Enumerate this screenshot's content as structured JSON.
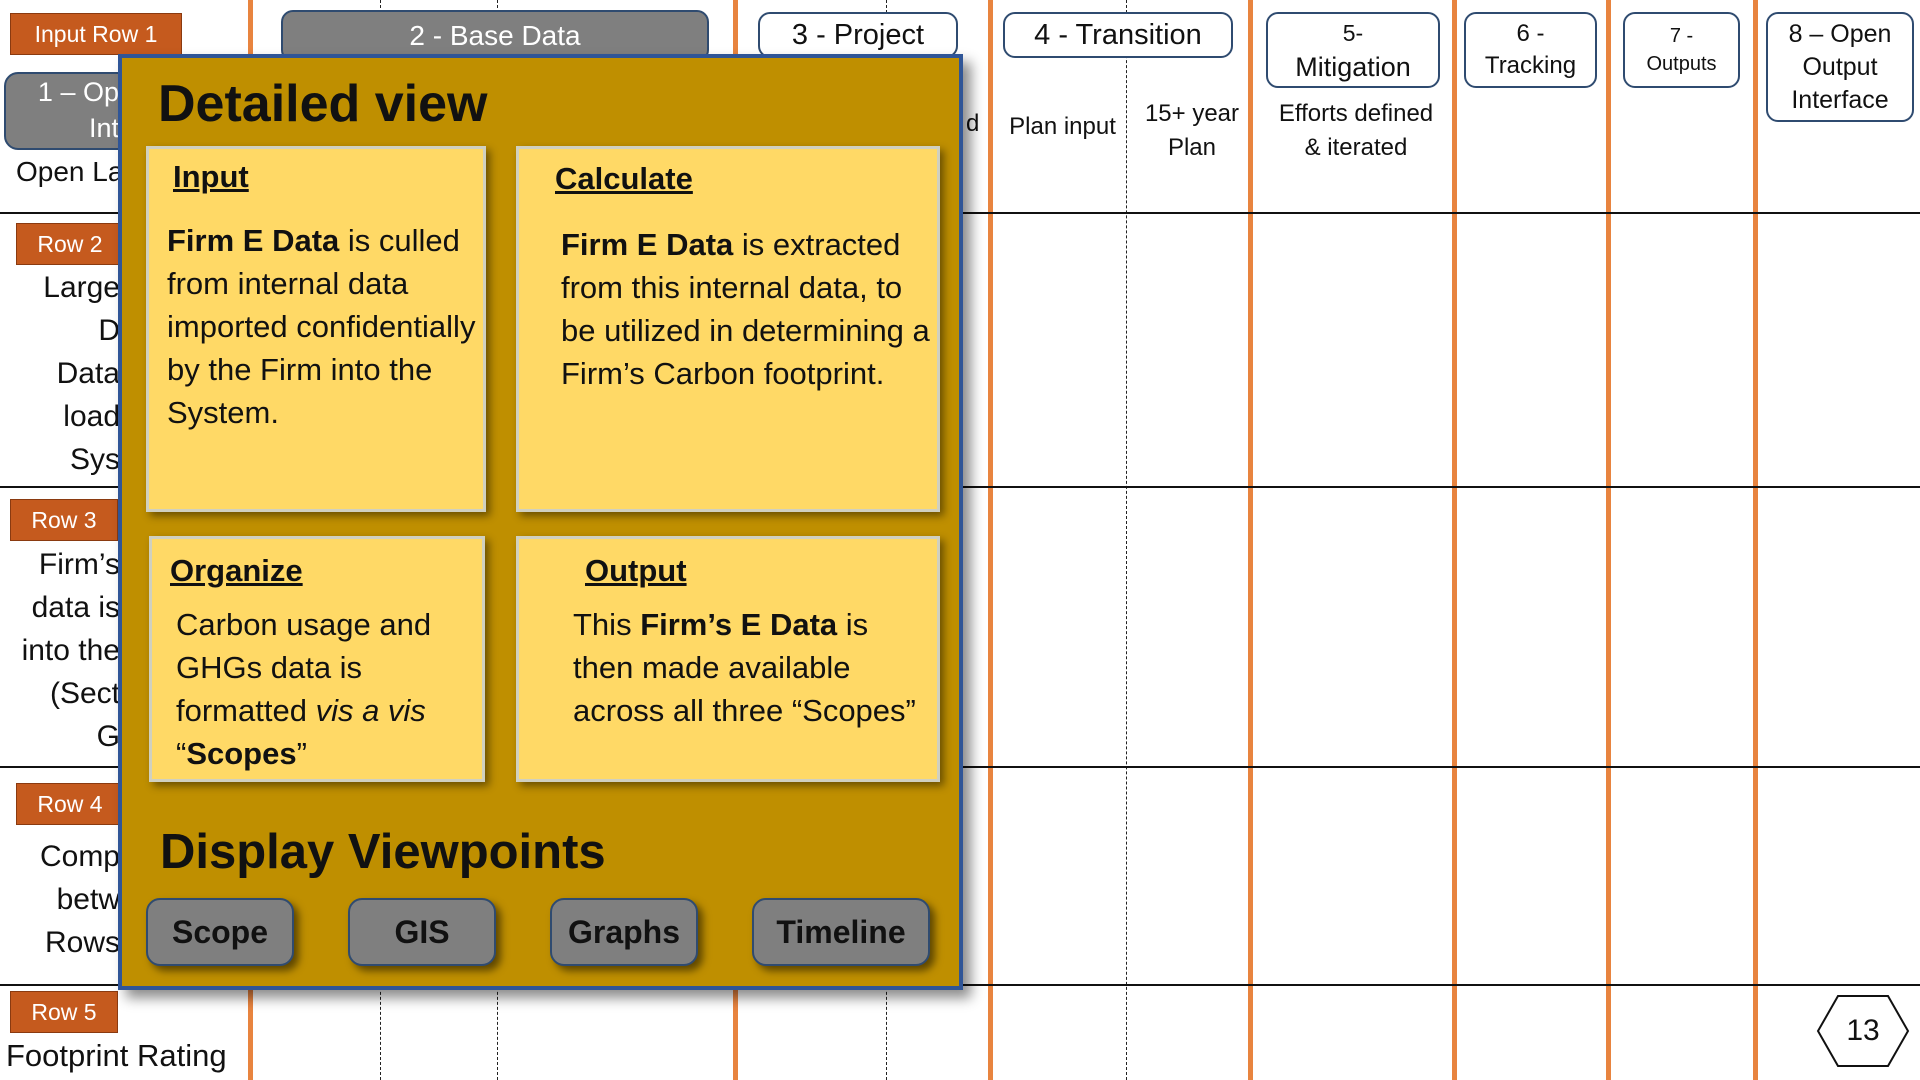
{
  "header": {
    "input_row_tag": "Input Row 1",
    "col1_line1": "1 – Ope",
    "col1_line2": "Inte",
    "col1_sub": "Open La",
    "col2": "2 - Base Data",
    "col3": "3 - Project",
    "col3_sub": "d",
    "col4": "4 - Transition",
    "col4_sub_a": "Plan input",
    "col4_sub_b_1": "15+ year",
    "col4_sub_b_2": "Plan",
    "col5_line1": "5-",
    "col5_line2": "Mitigation",
    "col5_sub_1": "Efforts defined",
    "col5_sub_2": "& iterated",
    "col6_line1": "6 -",
    "col6_line2": "Tracking",
    "col7_line1": "7 -",
    "col7_line2": "Outputs",
    "col8_line1": "8 – Open",
    "col8_line2": "Output",
    "col8_line3": "Interface"
  },
  "rows": {
    "row2_tag": "Row 2",
    "row2_lines": [
      "Large",
      "D",
      "Data",
      "load",
      "Sys"
    ],
    "row3_tag": "Row 3",
    "row3_lines": [
      "Firm’s",
      "data is",
      "into the",
      "(Sect",
      "G"
    ],
    "row4_tag": "Row 4",
    "row4_lines": [
      "Comp",
      "betw",
      "Rows"
    ],
    "row5_tag": "Row 5",
    "row5_text": "Footprint Rating"
  },
  "panel": {
    "title": "Detailed view",
    "input": {
      "title": "Input",
      "bold": "Firm E Data",
      "rest": " is culled from internal data imported confidentially by the Firm into the System."
    },
    "calculate": {
      "title": "Calculate",
      "bold": "Firm E Data",
      "rest": " is extracted from this internal data, to be utilized in determining a Firm’s Carbon footprint."
    },
    "organize": {
      "title": "Organize",
      "text1": "Carbon usage and GHGs data is formatted ",
      "italic": "vis a vis",
      "text2": " “",
      "bold": "Scopes",
      "text3": "”"
    },
    "output": {
      "title": "Output",
      "text1": "This ",
      "bold": "Firm’s E Data",
      "text2": " is then made available across all three “Scopes”"
    },
    "display_title": "Display Viewpoints",
    "buttons": [
      "Scope",
      "GIS",
      "Graphs",
      "Timeline"
    ]
  },
  "page_number": "13",
  "colors": {
    "accent_orange": "#e8843f",
    "row_tag": "#c55a1e",
    "panel_bg": "#bf8f00",
    "card_bg": "#ffd966",
    "button_bg": "#7f7f7f",
    "border_blue": "#2f5597"
  }
}
